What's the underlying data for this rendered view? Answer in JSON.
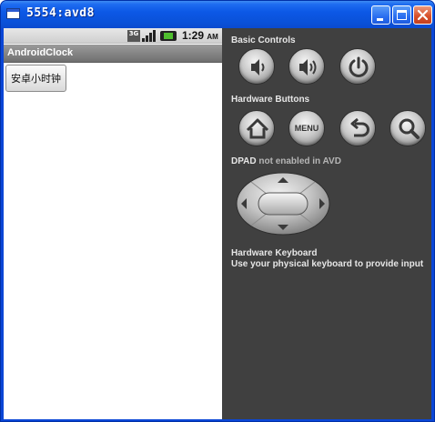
{
  "window": {
    "title": "5554:avd8"
  },
  "statusbar": {
    "network_badge": "3G",
    "time": "1:29",
    "ampm": "AM"
  },
  "app": {
    "title": "AndroidClock",
    "button_label": "安卓小时钟"
  },
  "panel": {
    "basic_controls_label": "Basic Controls",
    "hardware_buttons_label": "Hardware Buttons",
    "menu_label": "MENU",
    "dpad_label": "DPAD",
    "dpad_status": "not enabled in AVD",
    "keyboard_label": "Hardware Keyboard",
    "keyboard_hint": "Use your physical keyboard to provide input"
  },
  "colors": {
    "titlebar_blue": "#0a51d8",
    "panel_bg": "#404040",
    "close_red": "#d8512c"
  },
  "icons": [
    "window-app-icon",
    "minimize-icon",
    "maximize-icon",
    "close-icon",
    "network-3g-icon",
    "signal-icon",
    "battery-icon",
    "volume-down-icon",
    "volume-up-icon",
    "power-icon",
    "home-icon",
    "back-icon",
    "search-icon",
    "dpad-up-icon",
    "dpad-down-icon",
    "dpad-left-icon",
    "dpad-right-icon"
  ]
}
